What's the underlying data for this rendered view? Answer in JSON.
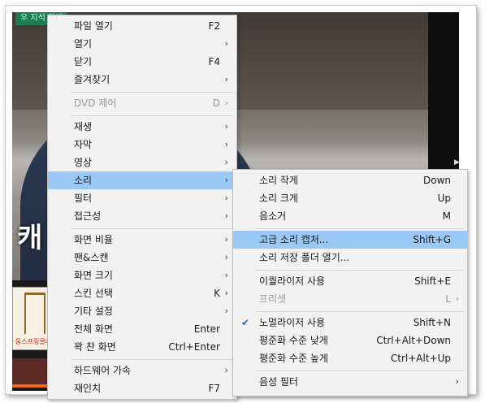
{
  "video": {
    "top_badge": "우 지석 연애",
    "caption": "캐",
    "thumb_label": "동스프링클러"
  },
  "main_menu": {
    "items": [
      {
        "label": "파일 열기",
        "shortcut": "F2"
      },
      {
        "label": "열기",
        "arrow": "›"
      },
      {
        "label": "닫기",
        "shortcut": "F4"
      },
      {
        "label": "즐겨찾기",
        "arrow": "›"
      },
      {
        "label": "DVD 제어",
        "shortcut": "D",
        "arrow": "›"
      },
      {
        "label": "재생",
        "arrow": "›"
      },
      {
        "label": "자막",
        "arrow": "›"
      },
      {
        "label": "영상",
        "arrow": "›"
      },
      {
        "label": "소리",
        "arrow": "›"
      },
      {
        "label": "필터",
        "arrow": "›"
      },
      {
        "label": "접근성",
        "arrow": "›"
      },
      {
        "label": "화면 비율",
        "arrow": "›"
      },
      {
        "label": "팬&스캔",
        "arrow": "›"
      },
      {
        "label": "화면 크기",
        "arrow": "›"
      },
      {
        "label": "스킨 선택",
        "shortcut": "K",
        "arrow": "›"
      },
      {
        "label": "기타 설정",
        "arrow": "›"
      },
      {
        "label": "전체 화면",
        "shortcut": "Enter"
      },
      {
        "label": "꽉 찬 화면",
        "shortcut": "Ctrl+Enter"
      },
      {
        "label": "하드웨어 가속",
        "arrow": "›"
      },
      {
        "label": "재인치",
        "shortcut": "F7"
      }
    ]
  },
  "sound_menu": {
    "items": [
      {
        "label": "소리 작게",
        "shortcut": "Down"
      },
      {
        "label": "소리 크게",
        "shortcut": "Up"
      },
      {
        "label": "음소거",
        "shortcut": "M"
      },
      {
        "label": "고급 소리 캡처...",
        "shortcut": "Shift+G"
      },
      {
        "label": "소리 저장 폴더 열기..."
      },
      {
        "label": "이퀄라이저 사용",
        "shortcut": "Shift+E"
      },
      {
        "label": "프리셋",
        "shortcut": "L",
        "arrow": "›"
      },
      {
        "label": "노멀라이저 사용",
        "shortcut": "Shift+N",
        "check": "✔"
      },
      {
        "label": "평준화 수준 낮게",
        "shortcut": "Ctrl+Alt+Down"
      },
      {
        "label": "평준화 수준 높게",
        "shortcut": "Ctrl+Alt+Up"
      },
      {
        "label": "음성 필터",
        "arrow": "›"
      }
    ]
  },
  "colors": {
    "highlight": "#99c9f4",
    "menu_bg": "#f2f2f2",
    "check": "#1f6ec8"
  }
}
